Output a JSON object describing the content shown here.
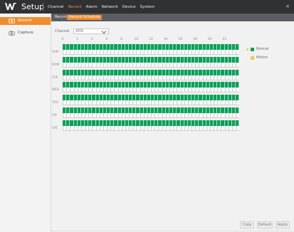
{
  "app": {
    "title": "Setup",
    "menu": [
      "Channel",
      "Record",
      "Alarm",
      "Network",
      "Device",
      "System"
    ],
    "active_menu": "Record",
    "close": "×"
  },
  "sidebar": {
    "items": [
      {
        "label": "Record",
        "icon": "record-icon",
        "active": true
      },
      {
        "label": "Capture",
        "icon": "camera-icon",
        "active": false
      }
    ]
  },
  "subtabs": [
    {
      "label": "Record",
      "active": false
    },
    {
      "label": "Record Schedule",
      "active": true
    }
  ],
  "channel": {
    "label": "Channel",
    "value": "CH1"
  },
  "hours": [
    "0",
    "2",
    "4",
    "6",
    "8",
    "10",
    "12",
    "14",
    "16",
    "18",
    "20",
    "22"
  ],
  "days": [
    "SUN",
    "MON",
    "TUE",
    "WED",
    "THU",
    "FRI",
    "SAT"
  ],
  "legend": [
    {
      "label": "Normal",
      "color": "#09a05a",
      "bullet": "#f2c84b"
    },
    {
      "label": "Motion",
      "color": "#f2c84b",
      "bullet": "#f0f0f0"
    }
  ],
  "buttons": {
    "copy": "Copy",
    "default": "Default",
    "apply": "Apply"
  },
  "colors": {
    "accent": "#f08c2e",
    "normal": "#09a05a"
  }
}
